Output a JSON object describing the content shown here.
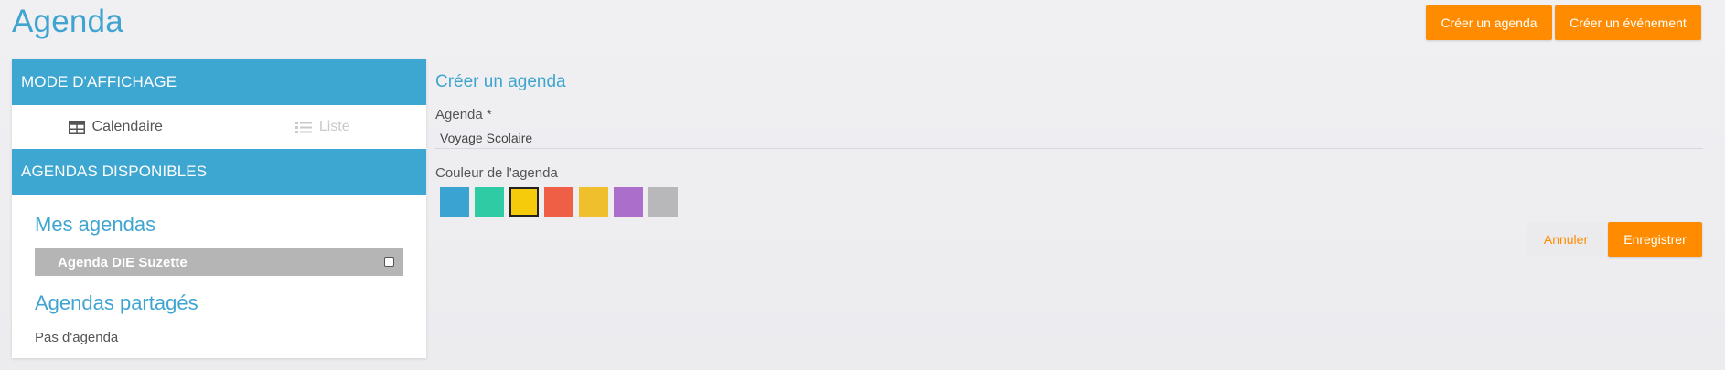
{
  "header": {
    "title": "Agenda",
    "create_agenda_label": "Créer un agenda",
    "create_event_label": "Créer un événement"
  },
  "sidebar": {
    "display_mode_header": "MODE D'AFFICHAGE",
    "view_modes": [
      {
        "label": "Calendaire",
        "icon": "calendar-grid-icon",
        "active": true
      },
      {
        "label": "Liste",
        "icon": "list-icon",
        "active": false
      }
    ],
    "available_header": "AGENDAS DISPONIBLES",
    "my_agendas_title": "Mes agendas",
    "my_agendas": [
      {
        "label": "Agenda DIE Suzette",
        "checked": false
      }
    ],
    "shared_title": "Agendas partagés",
    "shared_empty": "Pas d'agenda"
  },
  "form": {
    "title": "Créer un agenda",
    "agenda_label": "Agenda *",
    "agenda_value": "Voyage Scolaire",
    "color_label": "Couleur de l'agenda",
    "colors": [
      "#3aa3d1",
      "#2ecba5",
      "#f5cb0c",
      "#ee5f45",
      "#f0bf2e",
      "#ab6fcb",
      "#b8b8ba"
    ],
    "selected_color_index": 2,
    "cancel_label": "Annuler",
    "save_label": "Enregistrer"
  },
  "theme": {
    "accent": "#3da6d1",
    "orange": "#ff8c00"
  }
}
